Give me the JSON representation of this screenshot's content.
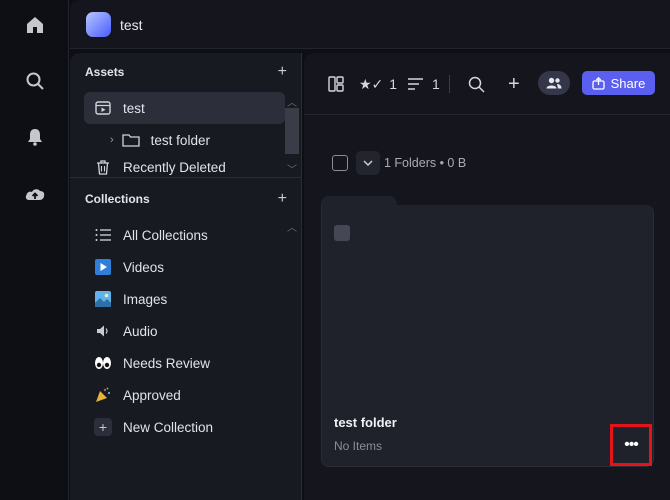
{
  "project": {
    "name": "test"
  },
  "assets": {
    "heading": "Assets",
    "items": [
      {
        "label": "test",
        "icon": "project-icon"
      },
      {
        "label": "test folder",
        "icon": "folder-icon"
      },
      {
        "label": "Recently Deleted",
        "icon": "trash-icon"
      }
    ]
  },
  "collections": {
    "heading": "Collections",
    "items": [
      {
        "label": "All Collections",
        "icon": "list-icon"
      },
      {
        "label": "Videos",
        "icon": "video-icon"
      },
      {
        "label": "Images",
        "icon": "image-icon"
      },
      {
        "label": "Audio",
        "icon": "speaker-icon"
      },
      {
        "label": "Needs Review",
        "icon": "eyes-icon"
      },
      {
        "label": "Approved",
        "icon": "party-popper-icon"
      },
      {
        "label": "New Collection",
        "icon": "plus-icon"
      }
    ]
  },
  "toolbar": {
    "filter_count": "1",
    "sort_count": "1",
    "share_label": "Share"
  },
  "content": {
    "summary": "1 Folders • 0 B",
    "folder": {
      "name": "test folder",
      "subtitle": "No Items"
    },
    "more_label": "•••"
  },
  "colors": {
    "accent": "#5b5ff0",
    "highlight": "#e5141b"
  }
}
